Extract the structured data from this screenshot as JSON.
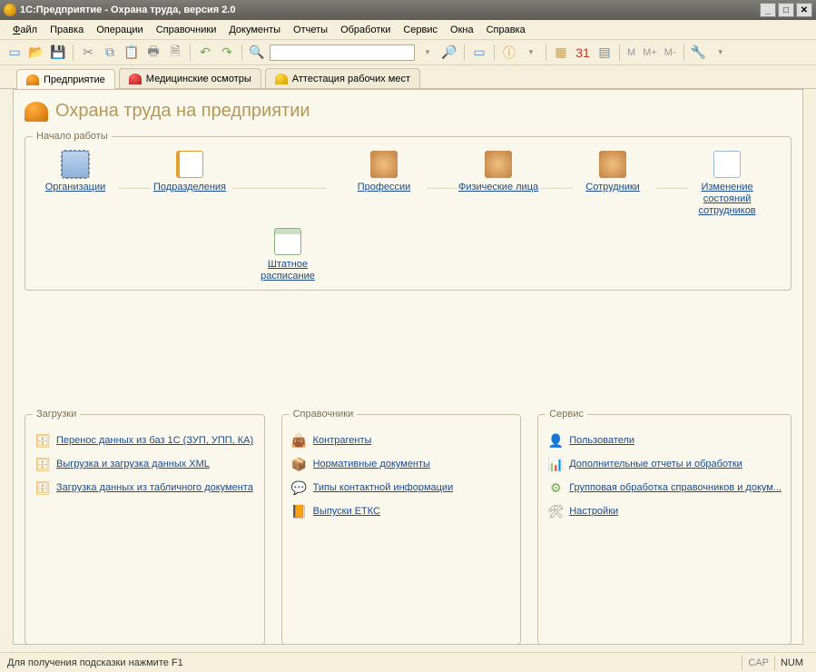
{
  "window": {
    "title": "1С:Предприятие - Охрана труда, версия 2.0"
  },
  "menu": {
    "file": "Файл",
    "edit": "Правка",
    "operations": "Операции",
    "directories": "Справочники",
    "documents": "Документы",
    "reports": "Отчеты",
    "processing": "Обработки",
    "service": "Сервис",
    "windows": "Окна",
    "help": "Справка"
  },
  "toolbar": {
    "memory_m": "M",
    "memory_mplus": "M+",
    "memory_mminus": "M-"
  },
  "tabs": {
    "t1": "Предприятие",
    "t2": "Медицинские осмотры",
    "t3": "Аттестация рабочих мест"
  },
  "page": {
    "title": "Охрана труда на предприятии"
  },
  "group_start": {
    "legend": "Начало работы"
  },
  "flow": {
    "org": "Организации",
    "div": "Подразделения",
    "prof": "Профессии",
    "persons": "Физические лица",
    "emp": "Сотрудники",
    "change": "Изменение состояний сотрудников",
    "staff": "Штатное расписание"
  },
  "col_zagruzki": {
    "legend": "Загрузки",
    "l1": "Перенос данных из баз 1С (ЗУП, УПП, КА)",
    "l2": "Выгрузка и загрузка данных XML",
    "l3": "Загрузка данных из табличного документа"
  },
  "col_sprav": {
    "legend": "Справочники",
    "l1": "Контрагенты",
    "l2": "Нормативные документы",
    "l3": "Типы контактной информации",
    "l4": "Выпуски ЕТКС"
  },
  "col_service": {
    "legend": "Сервис",
    "l1": "Пользователи",
    "l2": "Дополнительные отчеты и обработки",
    "l3": "Групповая обработка справочников и докум...",
    "l4": "Настройки"
  },
  "status": {
    "hint": "Для получения подсказки нажмите F1",
    "cap": "CAP",
    "num": "NUM"
  }
}
